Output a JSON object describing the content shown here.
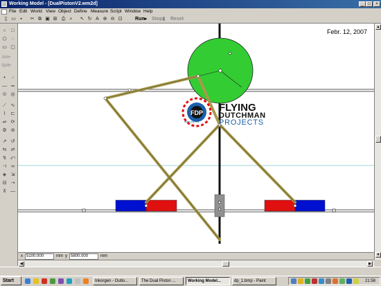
{
  "window": {
    "title": "Working Model - [DualPistonV2.wm2d]"
  },
  "menu": [
    "File",
    "Edit",
    "World",
    "View",
    "Object",
    "Define",
    "Measure",
    "Script",
    "Window",
    "Help"
  ],
  "toolbar": {
    "run": "Run▸",
    "stop": "Stop▮",
    "reset": "Reset"
  },
  "tools": {
    "join": "Join•",
    "split": "Split•"
  },
  "canvas": {
    "date": "Febr. 12, 2007",
    "logo_initials": "FDP",
    "logo_line1": "FLYING",
    "logo_line2": "DUTCHMAN",
    "logo_line3": "PROJECTS",
    "logo_url": "www.fdp.nu",
    "colors": {
      "wheel": "#33cc33",
      "rod": "#a89a4c",
      "blue_block": "#0010d0",
      "red_block": "#e01010",
      "slider": "#909090"
    }
  },
  "coords": {
    "x_label": "x",
    "x_value": "5100.000",
    "x_unit": "mm",
    "y_label": "y",
    "y_value": "5800.000",
    "y_unit": "mm"
  },
  "taskbar": {
    "start": "Start",
    "tasks": [
      "Inkorgen - Outlo...",
      "The Dual Piston ...",
      "Working Model...",
      "dp_1.bmp - Paint"
    ],
    "clock": "21:58"
  }
}
